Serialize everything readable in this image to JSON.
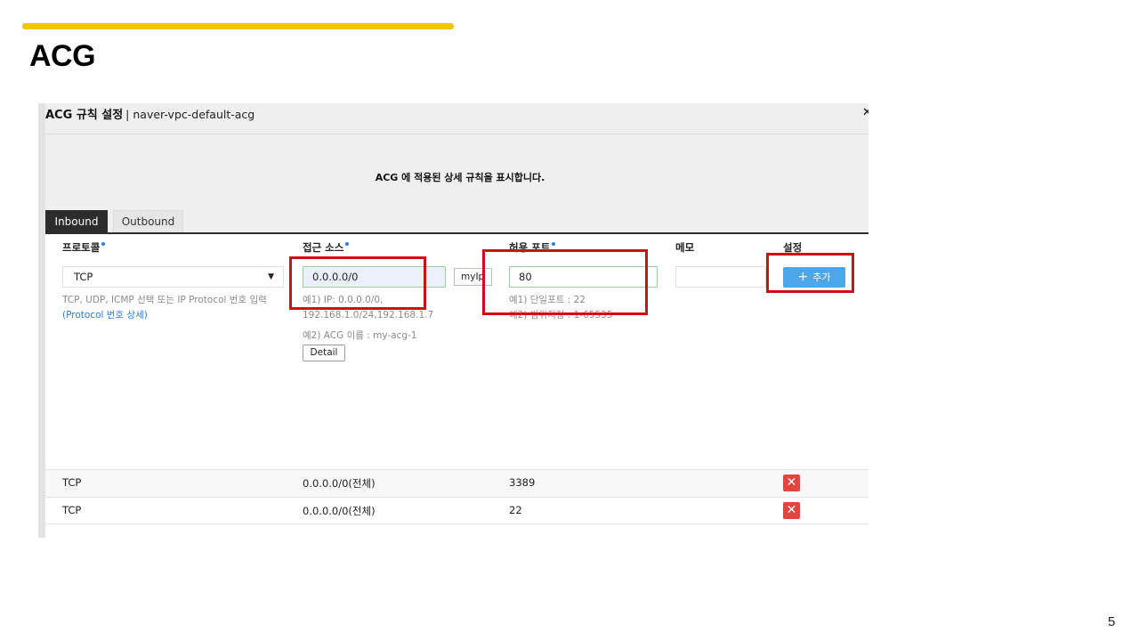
{
  "slide": {
    "title": "ACG",
    "page_number": "5"
  },
  "colors": {
    "accent_bar": "#f5c400",
    "highlight": "#d10f0f",
    "add_button": "#4da6e8",
    "delete_button": "#e2453d",
    "active_tab": "#2c2c2c"
  },
  "modal": {
    "title": "ACG 규칙 설정",
    "subtitle": "| naver-vpc-default-acg",
    "close_icon": "close-icon",
    "description": "ACG 에 적용된 상세 규칙을 표시합니다."
  },
  "tabs": [
    {
      "label": "Inbound",
      "active": true
    },
    {
      "label": "Outbound",
      "active": false
    }
  ],
  "table": {
    "headers": {
      "protocol": "프로토콜",
      "source": "접근 소스",
      "port": "허용 포트",
      "memo": "메모",
      "settings": "설정"
    },
    "form": {
      "protocol_value": "TCP",
      "protocol_hint": "TCP, UDP, ICMP 선택 또는 IP Protocol 번호 입력",
      "protocol_link": "(Protocol 번호 상세)",
      "source_value": "0.0.0.0/0",
      "myip_label": "myIp",
      "source_hint_1a": "예1) IP: 0.0.0.0/0,",
      "source_hint_1b": "192.168.1.0/24,192.168.1.7",
      "source_hint_2": "예2) ACG 이름 : my-acg-1",
      "detail_label": "Detail",
      "port_value": "80",
      "port_hint_1": "예1) 단일포트 : 22",
      "port_hint_2": "예2) 범위지정 : 1-65535",
      "memo_value": "",
      "add_label": "추가"
    },
    "rows": [
      {
        "protocol": "TCP",
        "source": "0.0.0.0/0(전체)",
        "port": "3389"
      },
      {
        "protocol": "TCP",
        "source": "0.0.0.0/0(전체)",
        "port": "22"
      }
    ]
  }
}
